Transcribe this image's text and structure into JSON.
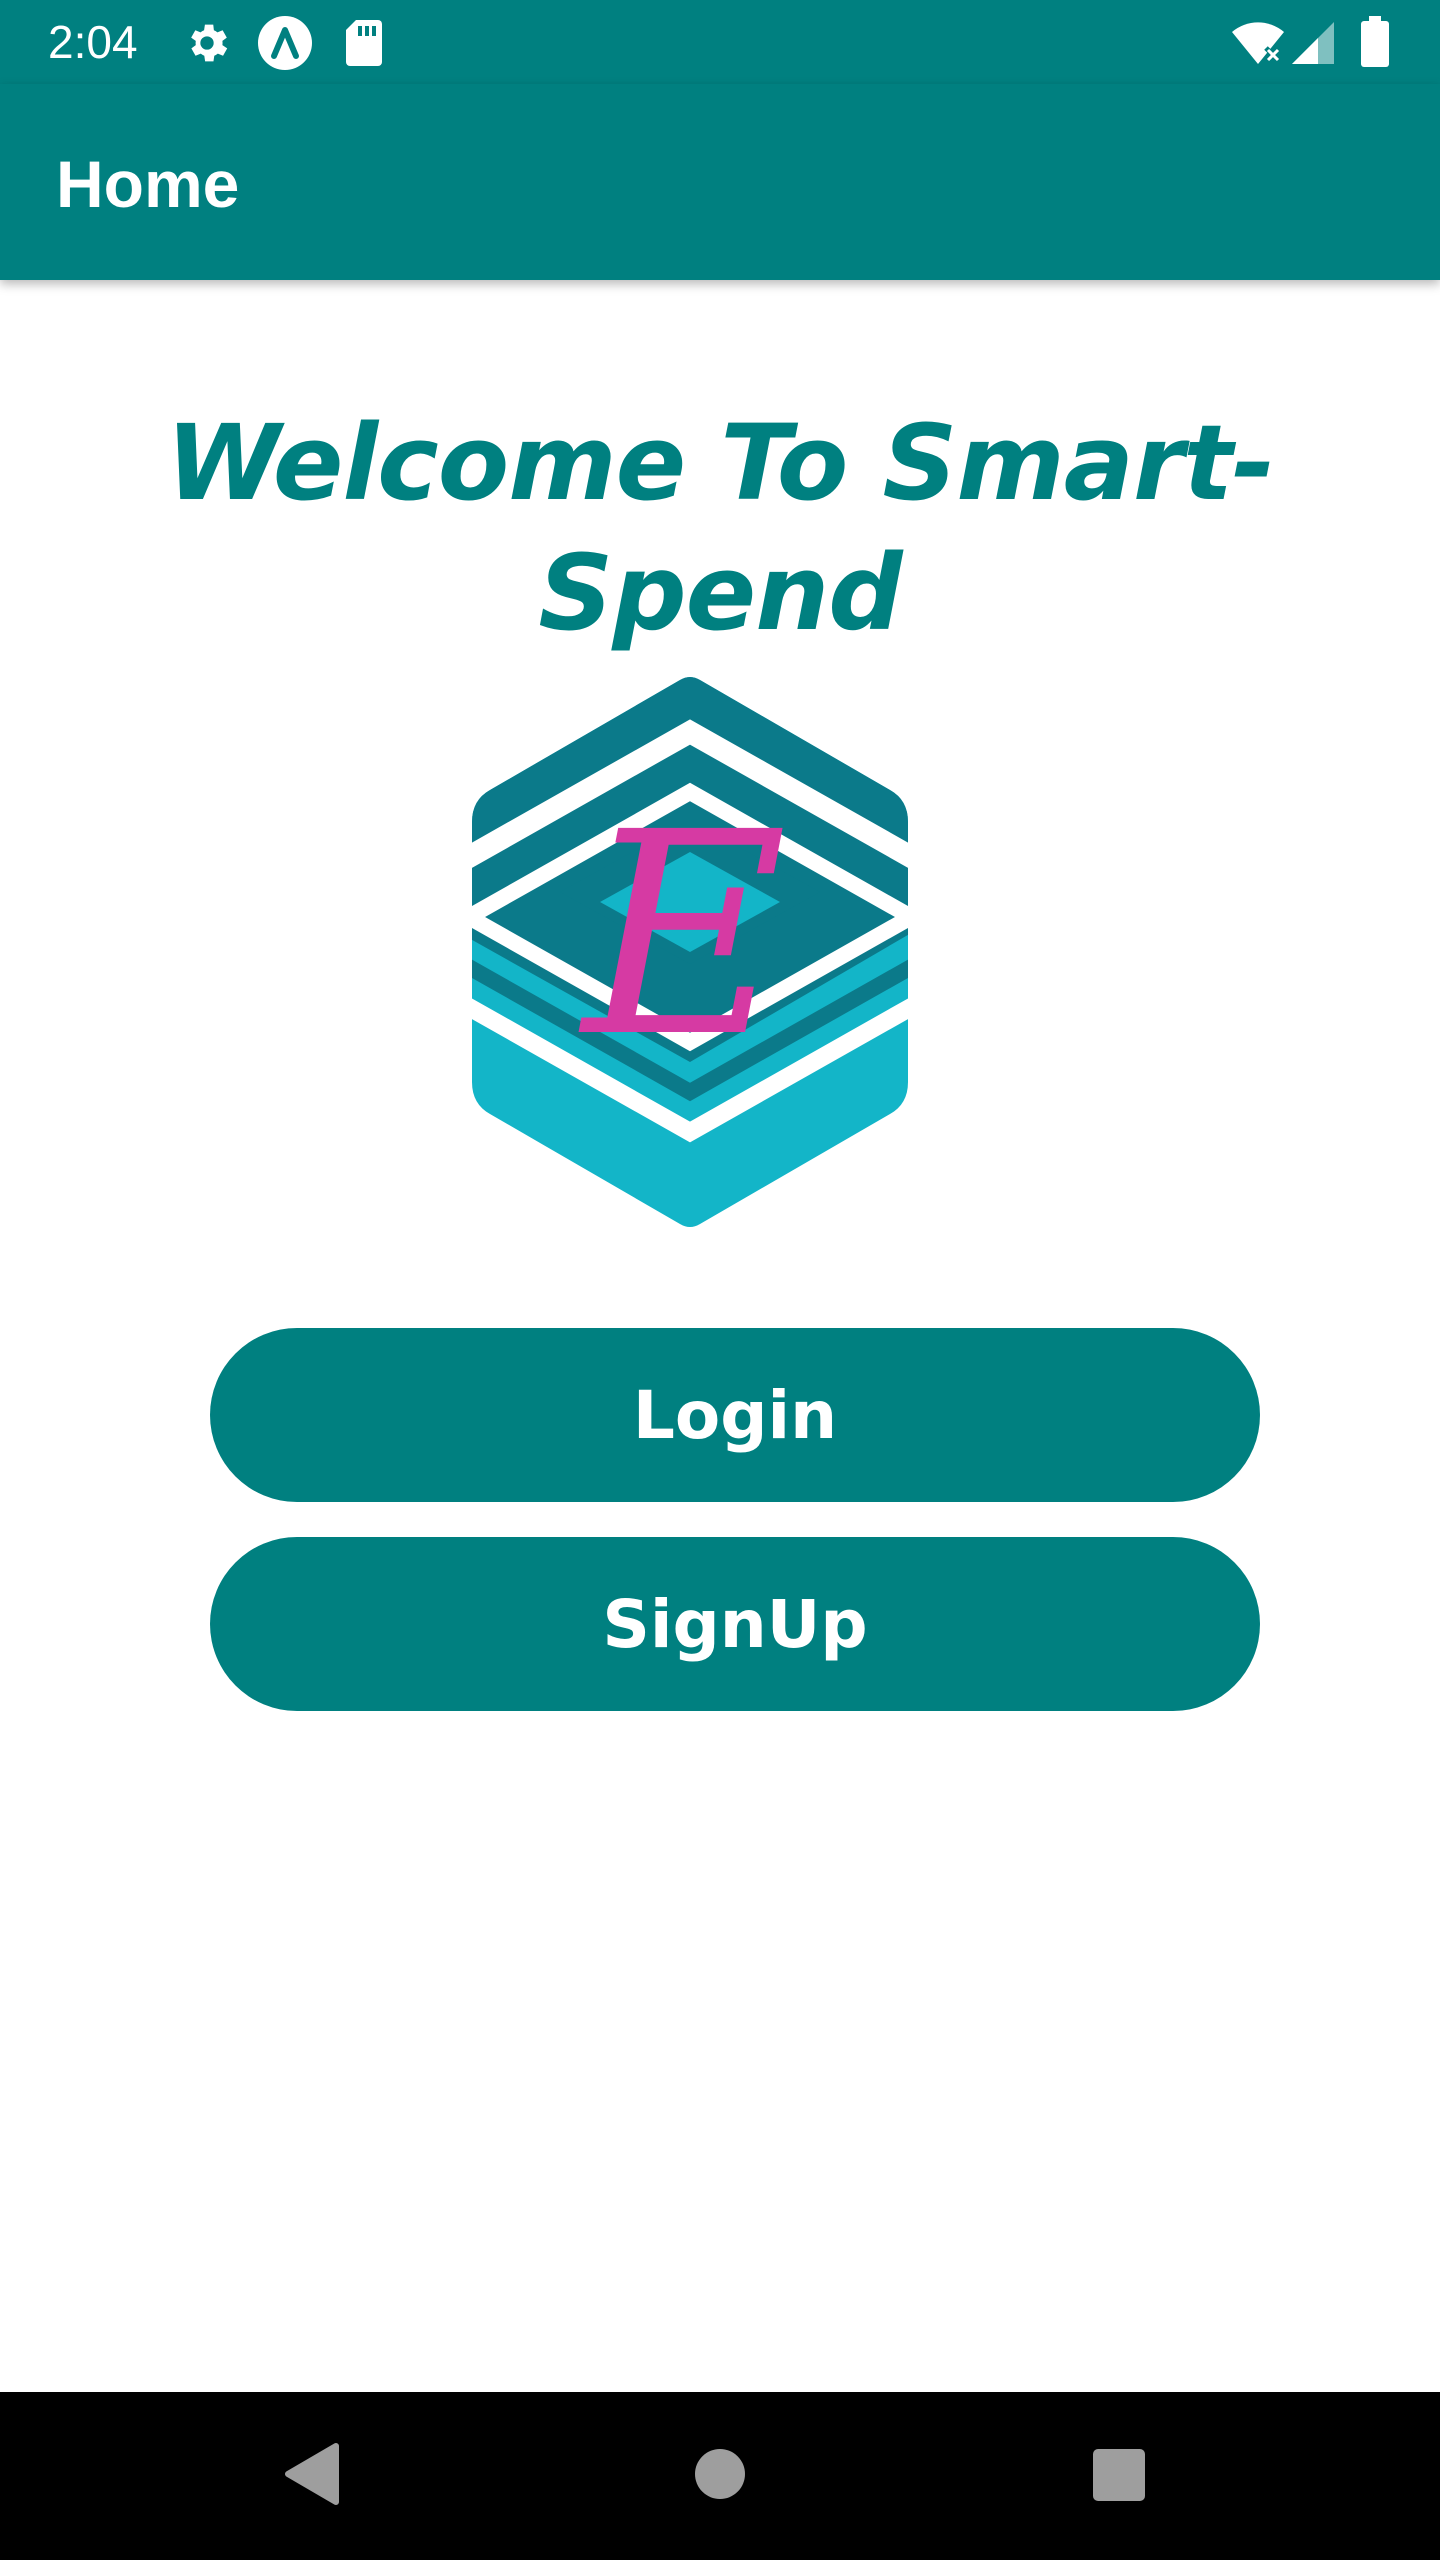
{
  "status_bar": {
    "time": "2:04",
    "icons": [
      "gear-icon",
      "a-circle-icon",
      "sd-card-icon",
      "wifi-x-icon",
      "signal-icon",
      "battery-icon"
    ]
  },
  "app_bar": {
    "title": "Home"
  },
  "main": {
    "welcome_text": "Welcome To Smart-Spend",
    "logo_letter": "E",
    "buttons": {
      "login_label": "Login",
      "signup_label": "SignUp"
    }
  },
  "nav_bar": {
    "icons": [
      "back-icon",
      "home-icon",
      "recents-icon"
    ]
  },
  "colors": {
    "primary": "#008080",
    "logo_dark": "#0B7A8A",
    "logo_light": "#13B5C8",
    "logo_letter": "#D63AA3",
    "nav_icon": "#9E9E9E"
  }
}
